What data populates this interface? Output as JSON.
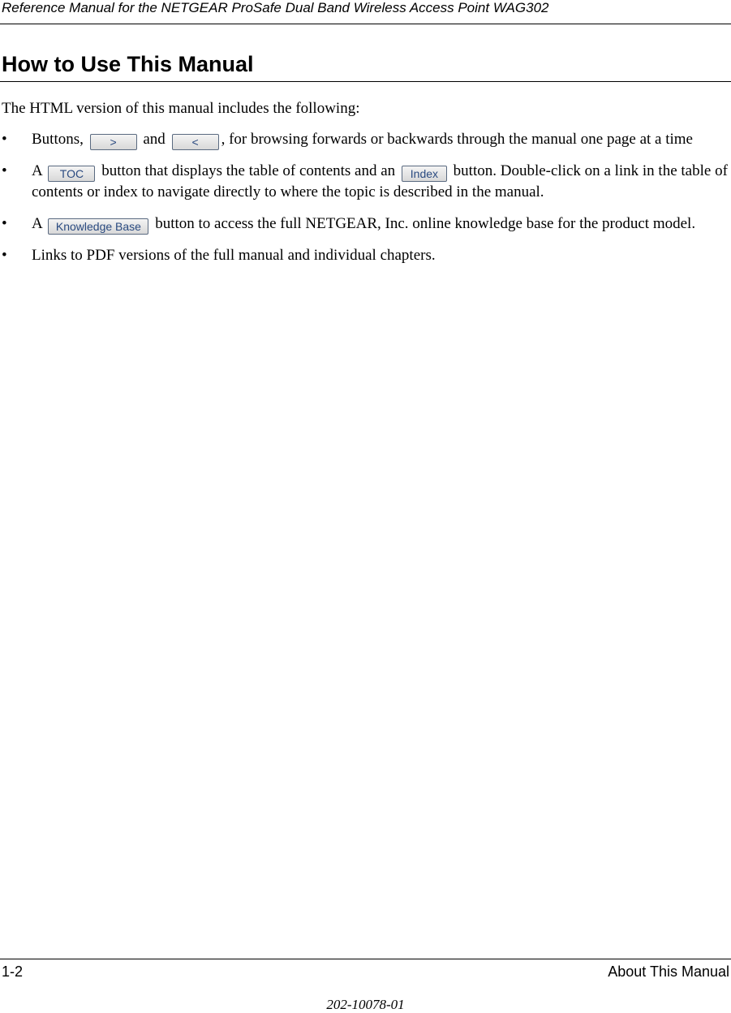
{
  "header": {
    "running_title": "Reference Manual for the NETGEAR ProSafe Dual Band Wireless Access Point WAG302"
  },
  "section": {
    "title": "How to Use This Manual"
  },
  "intro": "The HTML version of this manual includes the following:",
  "bullets": {
    "b1": {
      "pre": "Buttons, ",
      "btn1": ">",
      "mid": " and ",
      "btn2": "<",
      "post": ", for browsing forwards or backwards through the manual one page at a time"
    },
    "b2": {
      "pre": "A ",
      "btn1": "TOC",
      "mid": " button that displays the table of contents and an ",
      "btn2": "Index",
      "post": " button. Double-click on a link in the table of contents or index to navigate directly to where the topic is described in the manual."
    },
    "b3": {
      "pre": "A ",
      "btn1": "Knowledge Base",
      "post": " button to access the full NETGEAR, Inc. online knowledge base for the product model."
    },
    "b4": {
      "text": "Links to PDF versions of the full manual and individual chapters."
    },
    "marker": "•"
  },
  "footer": {
    "page": "1-2",
    "chapter": "About This Manual",
    "doc_number": "202-10078-01"
  }
}
